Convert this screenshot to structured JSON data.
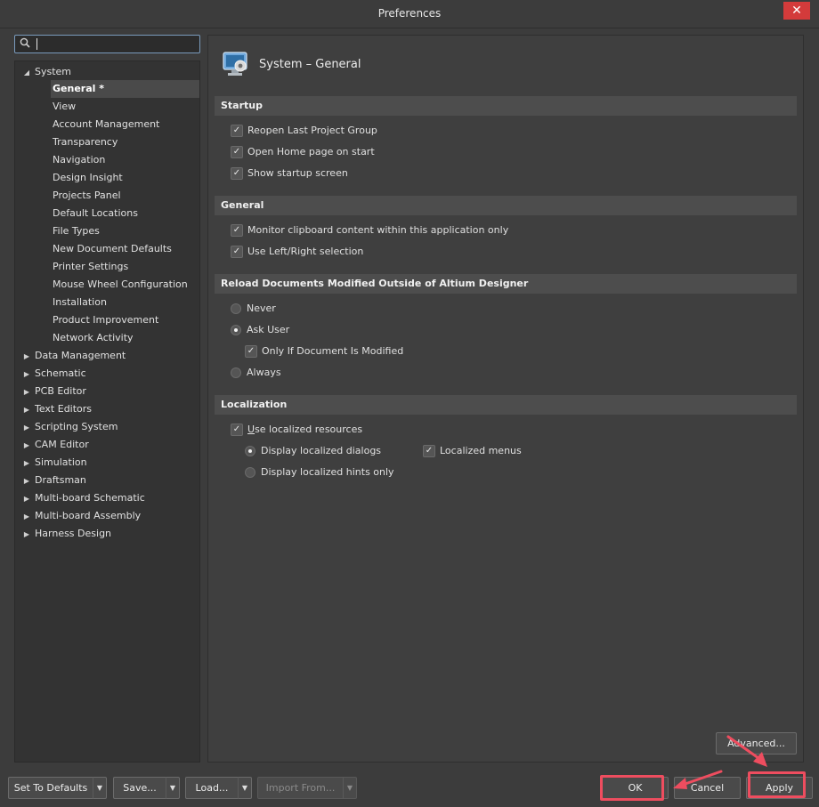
{
  "window": {
    "title": "Preferences",
    "close_glyph": "✕"
  },
  "search": {
    "value": "",
    "placeholder": "",
    "icon": "search-icon"
  },
  "tree": {
    "root": {
      "label": "System",
      "expanded": true
    },
    "children": [
      {
        "label": "General *",
        "selected": true
      },
      {
        "label": "View"
      },
      {
        "label": "Account Management"
      },
      {
        "label": "Transparency"
      },
      {
        "label": "Navigation"
      },
      {
        "label": "Design Insight"
      },
      {
        "label": "Projects Panel"
      },
      {
        "label": "Default Locations"
      },
      {
        "label": "File Types"
      },
      {
        "label": "New Document Defaults"
      },
      {
        "label": "Printer Settings"
      },
      {
        "label": "Mouse Wheel Configuration"
      },
      {
        "label": "Installation"
      },
      {
        "label": "Product Improvement"
      },
      {
        "label": "Network Activity"
      }
    ],
    "groups": [
      {
        "label": "Data Management"
      },
      {
        "label": "Schematic"
      },
      {
        "label": "PCB Editor"
      },
      {
        "label": "Text Editors"
      },
      {
        "label": "Scripting System"
      },
      {
        "label": "CAM Editor"
      },
      {
        "label": "Simulation"
      },
      {
        "label": "Draftsman"
      },
      {
        "label": "Multi-board Schematic"
      },
      {
        "label": "Multi-board Assembly"
      },
      {
        "label": "Harness Design"
      }
    ]
  },
  "page": {
    "title": "System – General"
  },
  "startup": {
    "header": "Startup",
    "reopen_last": {
      "label": "Reopen Last Project Group",
      "checked": true
    },
    "open_home": {
      "label": "Open Home page on start",
      "checked": true
    },
    "show_startup": {
      "label": "Show startup screen",
      "checked": true
    }
  },
  "general": {
    "header": "General",
    "monitor_clipboard": {
      "label": "Monitor clipboard content within this application only",
      "checked": true
    },
    "left_right": {
      "label": "Use Left/Right selection",
      "checked": true
    }
  },
  "reload": {
    "header": "Reload Documents Modified Outside of Altium Designer",
    "never": {
      "label": "Never",
      "selected": false
    },
    "ask_user": {
      "label": "Ask User",
      "selected": true
    },
    "only_if_modified": {
      "label": "Only If Document Is Modified",
      "checked": true
    },
    "always": {
      "label": "Always",
      "selected": false
    }
  },
  "localization": {
    "header": "Localization",
    "use_localized": {
      "label_prefix": "U",
      "label_rest": "se localized resources",
      "checked": true
    },
    "display_dialogs": {
      "label": "Display localized dialogs",
      "selected": true
    },
    "localized_menus": {
      "label": "Localized menus",
      "checked": true
    },
    "display_hints": {
      "label": "Display localized hints only",
      "selected": false
    }
  },
  "buttons": {
    "advanced": "Advanced...",
    "set_defaults": "Set To Defaults",
    "save": "Save...",
    "load": "Load...",
    "import_from": "Import From...",
    "ok": "OK",
    "cancel": "Cancel",
    "apply": "Apply",
    "dropdown_glyph": "▼"
  },
  "colors": {
    "annotation_highlight": "#ee4d5f",
    "close_button": "#d33b3b",
    "background": "#3c3c3c"
  }
}
